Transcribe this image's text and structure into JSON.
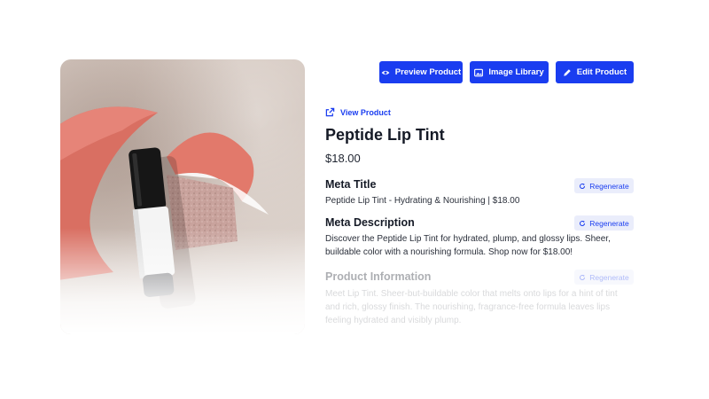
{
  "toolbar": {
    "preview_label": "Preview Product",
    "library_label": "Image Library",
    "edit_label": "Edit Product"
  },
  "product": {
    "view_link": "View Product",
    "title": "Peptide Lip Tint",
    "price": "$18.00"
  },
  "sections": {
    "meta_title": {
      "label": "Meta Title",
      "text": "Peptide Lip Tint - Hydrating & Nourishing | $18.00",
      "regen_label": "Regenerate"
    },
    "meta_description": {
      "label": "Meta Description",
      "text": "Discover the Peptide Lip Tint for hydrated, plump, and glossy lips. Sheer, buildable color with a nourishing formula. Shop now for $18.00!",
      "regen_label": "Regenerate"
    },
    "product_information": {
      "label": "Product Information",
      "text": "Meet Lip Tint. Sheer-but-buildable color that melts onto lips for a hint of tint and rich, glossy finish. The nourishing, fragrance-free formula leaves lips feeling hydrated and visibly plump.",
      "regen_label": "Regenerate"
    }
  },
  "colors": {
    "accent": "#1a3df0",
    "regen_bg": "#eaedfb",
    "coral": "#e0776a"
  },
  "icons": {
    "preview": "eye-icon",
    "library": "image-icon",
    "edit": "pencil-icon",
    "view": "external-link-icon",
    "regen": "refresh-icon"
  }
}
